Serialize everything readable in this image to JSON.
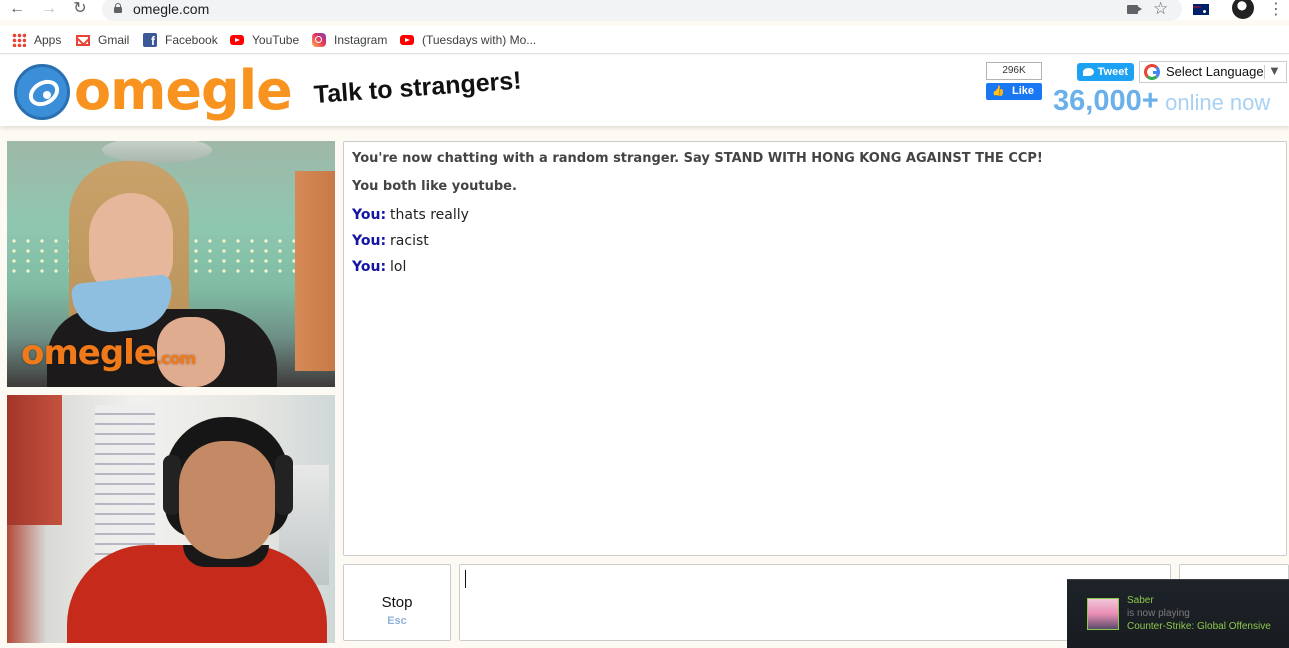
{
  "browser": {
    "url": "omegle.com",
    "bookmarks": [
      {
        "label": "Apps",
        "icon": "apps-grid-icon"
      },
      {
        "label": "Gmail",
        "icon": "gmail-icon"
      },
      {
        "label": "Facebook",
        "icon": "facebook-icon"
      },
      {
        "label": "YouTube",
        "icon": "youtube-icon"
      },
      {
        "label": "Instagram",
        "icon": "instagram-icon"
      },
      {
        "label": "(Tuesdays with) Mo...",
        "icon": "youtube-icon"
      }
    ]
  },
  "header": {
    "logo_text": "omegle",
    "tagline": "Talk to strangers!",
    "like_count": "296K",
    "like_label": "Like",
    "tweet_label": "Tweet",
    "language_label": "Select Language",
    "online_count": "36,000+",
    "online_label": "online now"
  },
  "video": {
    "watermark": "omegle",
    "watermark_suffix": ".com"
  },
  "chat": {
    "status_lines": [
      "You're now chatting with a random stranger. Say STAND WITH HONG KONG AGAINST THE CCP!",
      "You both like youtube."
    ],
    "messages": [
      {
        "who": "You:",
        "text": "thats really"
      },
      {
        "who": "You:",
        "text": "racist"
      },
      {
        "who": "You:",
        "text": "lol"
      }
    ],
    "stop_label": "Stop",
    "stop_key": "Esc",
    "input_value": ""
  },
  "toast": {
    "name": "Saber",
    "status": "is now playing",
    "game": "Counter-Strike: Global Offensive"
  },
  "colors": {
    "brand_orange": "#f7931e",
    "brand_blue": "#3a8fd8",
    "you_label": "#1414a5",
    "steam_green": "#8cc84b"
  }
}
